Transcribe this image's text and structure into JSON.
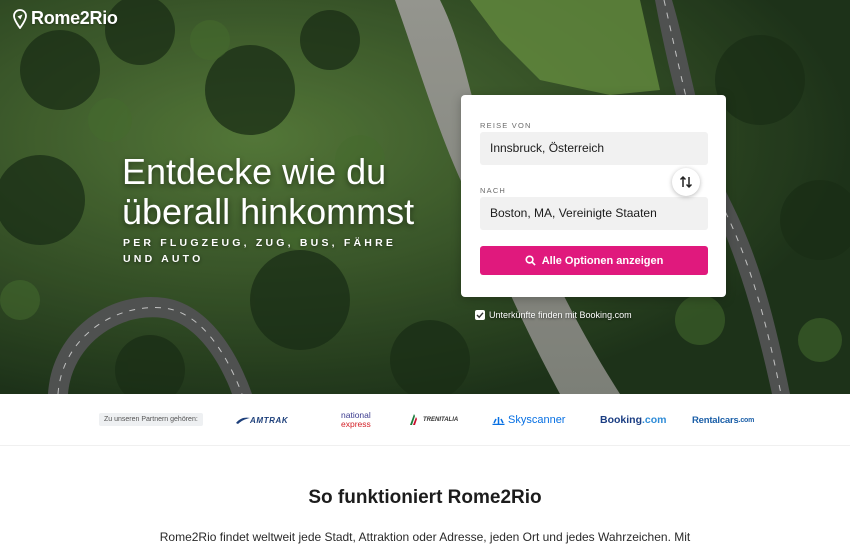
{
  "brand": {
    "name": "Rome2Rio"
  },
  "hero": {
    "title": "Entdecke wie du überall hinkommst",
    "subtitle": "PER FLUGZEUG, ZUG, BUS, FÄHRE UND AUTO"
  },
  "search": {
    "from_label": "REISE VON",
    "from_value": "Innsbruck, Österreich",
    "to_label": "NACH",
    "to_value": "Boston, MA, Vereinigte Staaten",
    "swap_icon": "swap-vertical-icon",
    "button_label": "Alle Optionen anzeigen",
    "button_icon": "search-icon",
    "booking_checkbox_label": "Unterkünfte finden mit Booking.com",
    "booking_checked": true
  },
  "partners": {
    "label": "Zu unseren Partnern gehören:",
    "amtrak": "AMTRAK",
    "national_line1": "national",
    "national_line2": "express",
    "trenitalia": "TRENITALIA",
    "skyscanner": "Skyscanner",
    "booking_main": "Booking",
    "booking_tld": ".com",
    "rentalcars_main": "Rentalcars",
    "rentalcars_tld": ".com"
  },
  "how": {
    "title": "So funktioniert Rome2Rio",
    "text": "Rome2Rio findet weltweit jede Stadt, Attraktion oder Adresse, jeden Ort und jedes Wahrzeichen. Mit"
  },
  "colors": {
    "accent": "#e0197d",
    "forest": "#2f4a27"
  }
}
